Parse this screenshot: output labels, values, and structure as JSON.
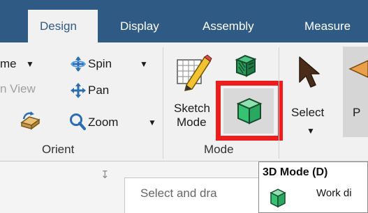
{
  "tabs": [
    {
      "label": "Design",
      "active": true
    },
    {
      "label": "Display",
      "active": false
    },
    {
      "label": "Assembly",
      "active": false
    },
    {
      "label": "Measure",
      "active": false
    }
  ],
  "orient": {
    "home_label": "me",
    "plan_view_label": "n View",
    "spin_label": "Spin",
    "pan_label": "Pan",
    "zoom_label": "Zoom",
    "group_label": "Orient"
  },
  "mode": {
    "sketch_label_line1": "Sketch",
    "sketch_label_line2": "Mode",
    "group_label": "Mode"
  },
  "select": {
    "label": "Select",
    "next_label_partial": "P"
  },
  "panel": {
    "pin_glyph": "↧",
    "search_placeholder": "Select and dra"
  },
  "tooltip": {
    "title": "3D Mode  (D)",
    "body": "Work di"
  },
  "colors": {
    "tabbar": "#2f5a84",
    "ribbon": "#f1f1f1",
    "highlight": "#ee1c1c",
    "cube_green": "#36c173"
  }
}
